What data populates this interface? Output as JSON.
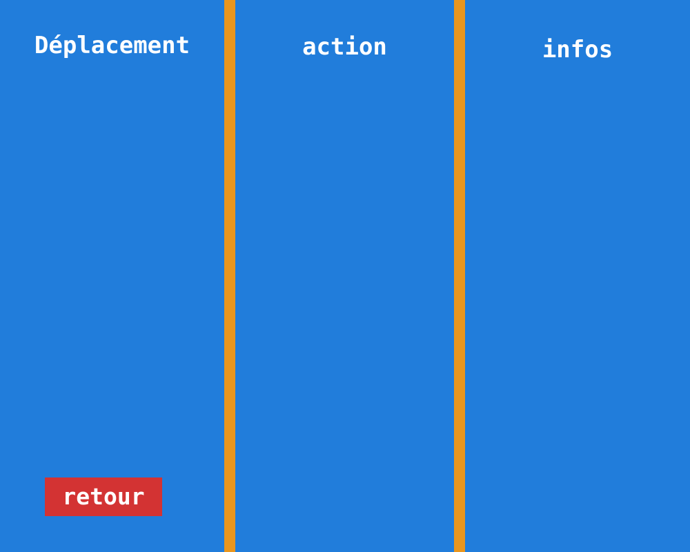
{
  "panels": {
    "movement": {
      "title": "Déplacement",
      "back_button_label": "retour"
    },
    "action": {
      "title": "action"
    },
    "info": {
      "title": "infos"
    }
  },
  "colors": {
    "panel_background": "#217ddb",
    "divider": "#e9961e",
    "back_button": "#d33333",
    "text": "#ffffff"
  }
}
